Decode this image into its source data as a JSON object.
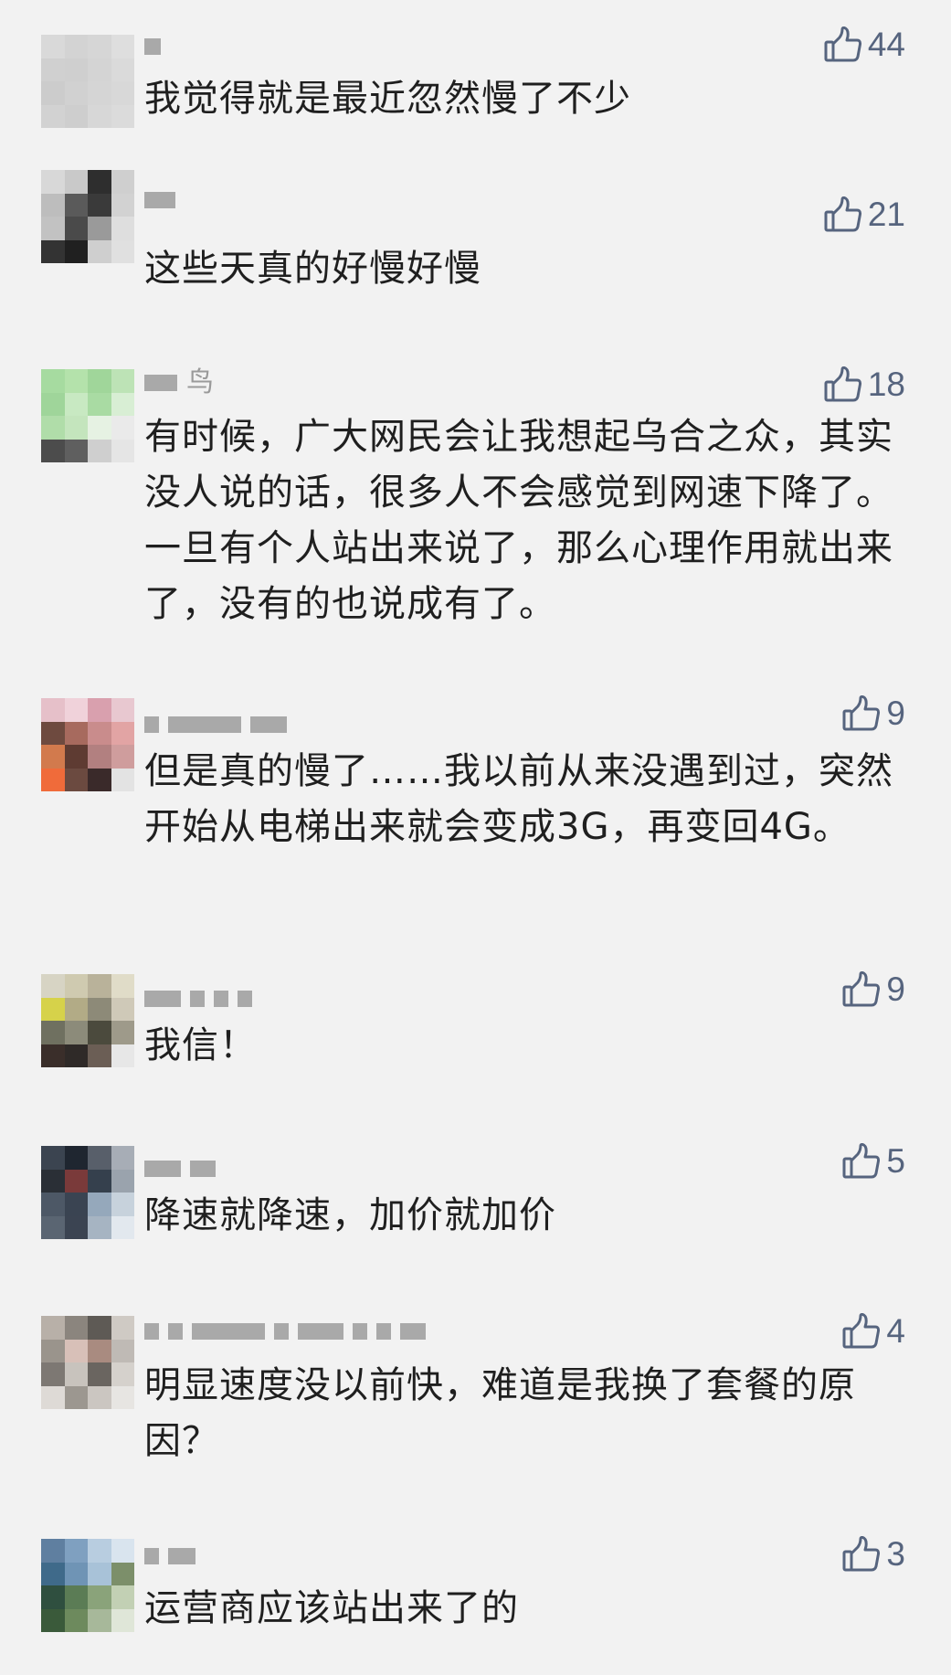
{
  "comments": [
    {
      "name_partial": "",
      "likes": "44",
      "text": "我觉得就是最近忽然慢了不少",
      "avatar_colors": [
        "#d9d9d9",
        "#d3d3d3",
        "#d6d6d6",
        "#dedede",
        "#d0d0d0",
        "#cfcfcf",
        "#d4d4d4",
        "#dadada",
        "#cccccc",
        "#d1d1d1",
        "#d5d5d5",
        "#d8d8d8",
        "#d2d2d2",
        "#cecece",
        "#d7d7d7",
        "#dbdbdb"
      ],
      "name_blocks": [
        18
      ]
    },
    {
      "name_partial": "",
      "likes": "21",
      "text": "这些天真的好慢好慢",
      "avatar_colors": [
        "#d8d8d8",
        "#c9c9c9",
        "#2e2e2e",
        "#cfcfcf",
        "#bdbdbd",
        "#5a5a5a",
        "#3a3a3a",
        "#d2d2d2",
        "#c2c2c2",
        "#4a4a4a",
        "#9a9a9a",
        "#dedede",
        "#333333",
        "#202020",
        "#cfcfcf",
        "#e0e0e0"
      ],
      "name_blocks": [
        34
      ]
    },
    {
      "name_partial": "鸟",
      "likes": "18",
      "text": "有时候，广大网民会让我想起乌合之众，其实没人说的话，很多人不会感觉到网速下降了。一旦有个人站出来说了，那么心理作用就出来了，没有的也说成有了。",
      "avatar_colors": [
        "#a6dba0",
        "#b4e2ab",
        "#a0d69a",
        "#bde3b6",
        "#9fd59a",
        "#c8e9c2",
        "#a9dba3",
        "#d8eed4",
        "#b0dda9",
        "#c4e5bd",
        "#e6f2e3",
        "#eaeaea",
        "#4c4c4c",
        "#5f5f5f",
        "#cfcfcf",
        "#e5e5e5"
      ],
      "name_blocks": [
        36
      ]
    },
    {
      "name_partial": "",
      "likes": "9",
      "text": "但是真的慢了……我以前从来没遇到过，突然开始从电梯出来就会变成3G，再变回4G。",
      "avatar_colors": [
        "#e6c0c9",
        "#f0d2da",
        "#d9a0ae",
        "#e8c8d0",
        "#6e4a3f",
        "#a76a5e",
        "#c98c8c",
        "#e2a4a4",
        "#d27a4d",
        "#5e3b32",
        "#b28080",
        "#cf9d9d",
        "#f06b3a",
        "#6b4a40",
        "#3a2a2a",
        "#e3e3e3"
      ],
      "name_blocks": [
        16,
        80,
        40
      ]
    },
    {
      "name_partial": "",
      "likes": "9",
      "text": "我信！",
      "avatar_colors": [
        "#d7d4c4",
        "#cfcab0",
        "#b9b29a",
        "#e0dcc8",
        "#d6d24a",
        "#b2ab86",
        "#8d8a78",
        "#cfc9b8",
        "#6f7060",
        "#8c8b7a",
        "#4b4a3d",
        "#9e9a8a",
        "#3a2e2a",
        "#2f2a28",
        "#6b5e55",
        "#e7e7e7"
      ],
      "name_blocks": [
        40,
        16,
        16,
        16
      ]
    },
    {
      "name_partial": "",
      "likes": "5",
      "text": "降速就降速，加价就加价",
      "avatar_colors": [
        "#3b4450",
        "#1f2630",
        "#585f6a",
        "#a7adb6",
        "#2a2f36",
        "#7a3a3a",
        "#35404d",
        "#9aa3ad",
        "#4d5866",
        "#3a4452",
        "#95a8bb",
        "#c7d2dc",
        "#5a6572",
        "#3b4452",
        "#a6b4c2",
        "#e2e8ee"
      ],
      "name_blocks": [
        40,
        28
      ]
    },
    {
      "name_partial": "",
      "likes": "4",
      "text": "明显速度没以前快，难道是我换了套餐的原因？",
      "avatar_colors": [
        "#b8b0a8",
        "#8b857e",
        "#5e5a55",
        "#cfcac4",
        "#9a948c",
        "#d8c0b8",
        "#a98b80",
        "#bfbab5",
        "#7d7873",
        "#c8c3bd",
        "#6a6560",
        "#d5d1cc",
        "#dedad6",
        "#9c9790",
        "#cbc6c1",
        "#e7e5e2"
      ],
      "name_blocks": [
        16,
        16,
        80,
        16,
        50,
        16,
        16,
        28
      ]
    },
    {
      "name_partial": "",
      "likes": "3",
      "text": "运营商应该站出来了的",
      "avatar_colors": [
        "#5f7fa0",
        "#7fa0c0",
        "#b8cde0",
        "#d9e4ee",
        "#3f6a8a",
        "#6f94b5",
        "#a8c2d8",
        "#7c8f6a",
        "#2f4f3f",
        "#5b7c55",
        "#8aa37a",
        "#c2d0b4",
        "#3a5a3a",
        "#6d8a5d",
        "#a7b89a",
        "#dfe6d8"
      ],
      "name_blocks": [
        16,
        30
      ]
    }
  ]
}
